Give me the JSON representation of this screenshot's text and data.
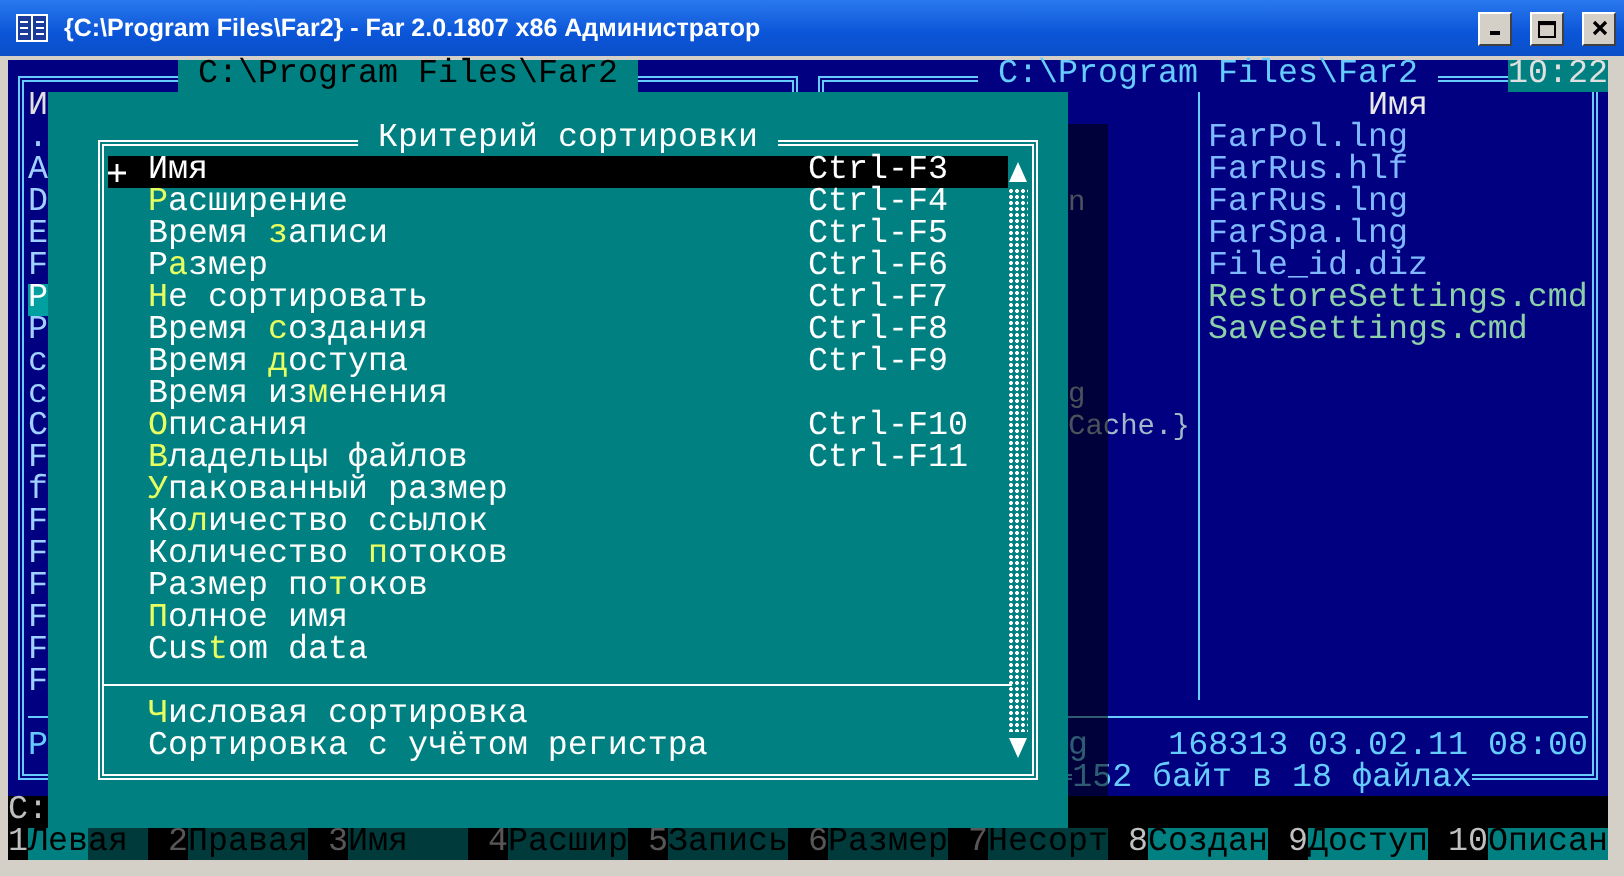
{
  "window": {
    "title": "{C:\\Program Files\\Far2} - Far 2.0.1807 x86 Администратор"
  },
  "left_panel": {
    "title": "C:\\Program Files\\Far2",
    "active": true,
    "header": "И",
    "rows": [
      {
        "name": ".",
        "selected": false
      },
      {
        "name": "A",
        "selected": false
      },
      {
        "name": "D",
        "selected": false
      },
      {
        "name": "E",
        "selected": false
      },
      {
        "name": "F",
        "selected": false
      },
      {
        "name": "P",
        "selected": true
      },
      {
        "name": "P",
        "selected": false
      },
      {
        "name": "c",
        "selected": false
      },
      {
        "name": "c",
        "selected": false
      },
      {
        "name": "C",
        "selected": false
      },
      {
        "name": "F",
        "selected": false
      },
      {
        "name": "f",
        "selected": false
      },
      {
        "name": "F",
        "selected": false
      },
      {
        "name": "F",
        "selected": false
      },
      {
        "name": "F",
        "selected": false
      },
      {
        "name": "F",
        "selected": false
      },
      {
        "name": "F",
        "selected": false
      },
      {
        "name": "F",
        "selected": false
      }
    ],
    "status": "P"
  },
  "right_panel": {
    "title": "C:\\Program Files\\Far2",
    "active": false,
    "clock": "10:22",
    "header": "Имя",
    "rows": [
      {
        "column_2": "FarPol.lng",
        "color": "#7fb8ff"
      },
      {
        "column_2": "FarRus.hlf",
        "color": "#7fb8ff"
      },
      {
        "column_1": "n",
        "column_2": "FarRus.lng",
        "color": "#7fb8ff"
      },
      {
        "column_2": "FarSpa.lng",
        "color": "#7fb8ff"
      },
      {
        "column_2": "File_id.diz",
        "color": "#7fb8ff"
      },
      {
        "column_2": "RestoreSettings.cmd",
        "color": "#8ccfa8"
      },
      {
        "column_2": "SaveSettings.cmd",
        "color": "#8ccfa8"
      },
      {},
      {
        "column_1": "g"
      },
      {
        "column_1": "Cache.}"
      },
      {},
      {},
      {},
      {},
      {},
      {},
      {},
      {}
    ],
    "status_left": "g",
    "status": "168313 03.02.11 08:00",
    "summary": "152 байт в 18 файлах"
  },
  "sort_dialog": {
    "title": "Критерий сортировки",
    "items": [
      {
        "text": "Имя",
        "shortcut": "Ctrl-F3",
        "checked": true,
        "selected": true
      },
      {
        "hotkey": "Р",
        "after": "асширение",
        "shortcut": "Ctrl-F4",
        "checked": false,
        "selected": false
      },
      {
        "before": "Время ",
        "hotkey": "з",
        "after": "аписи",
        "shortcut": "Ctrl-F5",
        "checked": false,
        "selected": false
      },
      {
        "before": "Р",
        "hotkey": "а",
        "after": "змер",
        "shortcut": "Ctrl-F6",
        "checked": false,
        "selected": false
      },
      {
        "hotkey": "Н",
        "after": "е сортировать",
        "shortcut": "Ctrl-F7",
        "checked": false,
        "selected": false
      },
      {
        "before": "Время ",
        "hotkey": "с",
        "after": "оздания",
        "shortcut": "Ctrl-F8",
        "checked": false,
        "selected": false
      },
      {
        "before": "Время ",
        "hotkey": "д",
        "after": "оступа",
        "shortcut": "Ctrl-F9",
        "checked": false,
        "selected": false
      },
      {
        "before": "Время из",
        "hotkey": "м",
        "after": "енения",
        "checked": false,
        "selected": false
      },
      {
        "hotkey": "О",
        "after": "писания",
        "shortcut": "Ctrl-F10",
        "checked": false,
        "selected": false
      },
      {
        "hotkey": "В",
        "after": "ладельцы файлов",
        "shortcut": "Ctrl-F11",
        "checked": false,
        "selected": false
      },
      {
        "hotkey": "У",
        "after": "пакованный размер",
        "checked": false,
        "selected": false
      },
      {
        "before": "Ко",
        "hotkey": "л",
        "after": "ичество ссылок",
        "checked": false,
        "selected": false
      },
      {
        "before": "Количество ",
        "hotkey": "п",
        "after": "отоков",
        "checked": false,
        "selected": false
      },
      {
        "before": "Размер по",
        "hotkey": "т",
        "after": "оков",
        "checked": false,
        "selected": false
      },
      {
        "hotkey": "П",
        "after": "олное имя",
        "checked": false,
        "selected": false
      },
      {
        "before": "Cus",
        "hotkey": "t",
        "after": "om data",
        "checked": false,
        "selected": false
      }
    ],
    "options": [
      {
        "hotkey": "Ч",
        "after": "исловая сортировка",
        "checked": false,
        "selected": false
      },
      {
        "text": "Сортировка с учётом регистра",
        "checked": false,
        "selected": false
      }
    ]
  },
  "command_line": "C:",
  "keybar": [
    {
      "key": "1",
      "label": "Левая"
    },
    {
      "key": "2",
      "label": "Правая"
    },
    {
      "key": "3",
      "label": "Имя"
    },
    {
      "key": "4",
      "label": "Расшир"
    },
    {
      "key": "5",
      "label": "Запись"
    },
    {
      "key": "6",
      "label": "Размер"
    },
    {
      "key": "7",
      "label": "Несорт"
    },
    {
      "key": "8",
      "label": "Создан"
    },
    {
      "key": "9",
      "label": "Доступ"
    },
    {
      "key": "10",
      "label": "Описан"
    }
  ]
}
